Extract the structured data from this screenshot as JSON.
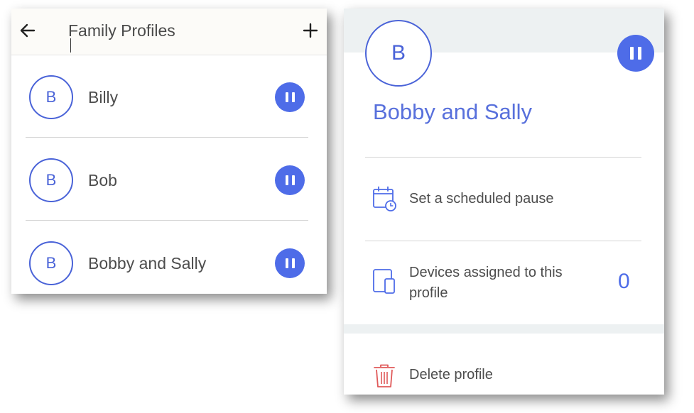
{
  "theme": {
    "accent": "#4e6ce8",
    "avatar_color": "#4a63d8",
    "delete_icon_color": "#e05a5a"
  },
  "list_screen": {
    "header": {
      "title": "Family Profiles",
      "back_icon": "arrow-left-icon",
      "add_icon": "plus-icon"
    },
    "profiles": [
      {
        "initial": "B",
        "name": "Billy",
        "action_icon": "pause-icon"
      },
      {
        "initial": "B",
        "name": "Bob",
        "action_icon": "pause-icon"
      },
      {
        "initial": "B",
        "name": "Bobby and Sally",
        "action_icon": "pause-icon"
      }
    ]
  },
  "detail_screen": {
    "initial": "B",
    "name": "Bobby and Sally",
    "action_icon": "pause-icon",
    "items": {
      "schedule": {
        "label": "Set a scheduled pause",
        "icon": "calendar-clock-icon"
      },
      "devices": {
        "label": "Devices assigned to this profile",
        "count": "0",
        "icon": "devices-icon"
      },
      "delete": {
        "label": "Delete profile",
        "icon": "trash-icon"
      }
    }
  }
}
